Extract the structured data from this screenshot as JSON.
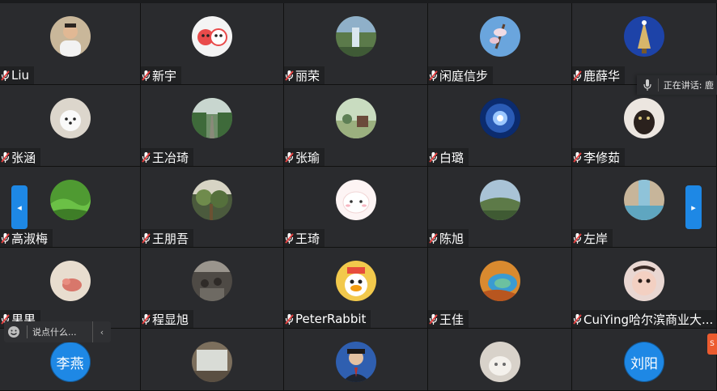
{
  "participants": [
    {
      "name": "Liu",
      "avatar": "man-photo"
    },
    {
      "name": "新宇",
      "avatar": "cow-mascot"
    },
    {
      "name": "丽荣",
      "avatar": "waterfall-photo"
    },
    {
      "name": "闲庭信步",
      "avatar": "magnolia-photo"
    },
    {
      "name": "鹿薛华",
      "avatar": "pagoda-photo"
    },
    {
      "name": "张涵",
      "avatar": "white-dog-photo"
    },
    {
      "name": "王冶琦",
      "avatar": "forest-road-photo"
    },
    {
      "name": "张瑜",
      "avatar": "countryside-photo"
    },
    {
      "name": "白璐",
      "avatar": "light-burst-photo"
    },
    {
      "name": "李修茹",
      "avatar": "black-cat-photo"
    },
    {
      "name": "高淑梅",
      "avatar": "green-hills-photo"
    },
    {
      "name": "王朋吾",
      "avatar": "trees-photo"
    },
    {
      "name": "王琦",
      "avatar": "white-bunny-cartoon"
    },
    {
      "name": "陈旭",
      "avatar": "landscape-photo"
    },
    {
      "name": "左岸",
      "avatar": "waterfall-blue-photo"
    },
    {
      "name": "果果",
      "avatar": "drawing-photo"
    },
    {
      "name": "程显旭",
      "avatar": "classroom-photo"
    },
    {
      "name": "PeterRabbit",
      "avatar": "cartoon-duck"
    },
    {
      "name": "王佳",
      "avatar": "hot-spring-photo"
    },
    {
      "name": "CuiYing哈尔滨商业大...",
      "avatar": "baby-photo"
    },
    {
      "name": "",
      "avatar_text": "李燕"
    },
    {
      "name": "",
      "avatar": "waterfall-wide-photo"
    },
    {
      "name": "",
      "avatar": "man-suit-photo"
    },
    {
      "name": "",
      "avatar": "cat-photo"
    },
    {
      "name": "",
      "avatar_text": "刘阳"
    }
  ],
  "speaking_label": "正在讲话: 鹿",
  "chat_placeholder": "说点什么...",
  "collapse_glyph": "‹",
  "prev_glyph": "◂",
  "next_glyph": "▸",
  "side_tag_text": "S",
  "colors": {
    "accent": "#1e88e5",
    "tile_bg": "#2a2b2e",
    "mic_red": "#e84141",
    "side_tag": "#ec5b2f"
  }
}
